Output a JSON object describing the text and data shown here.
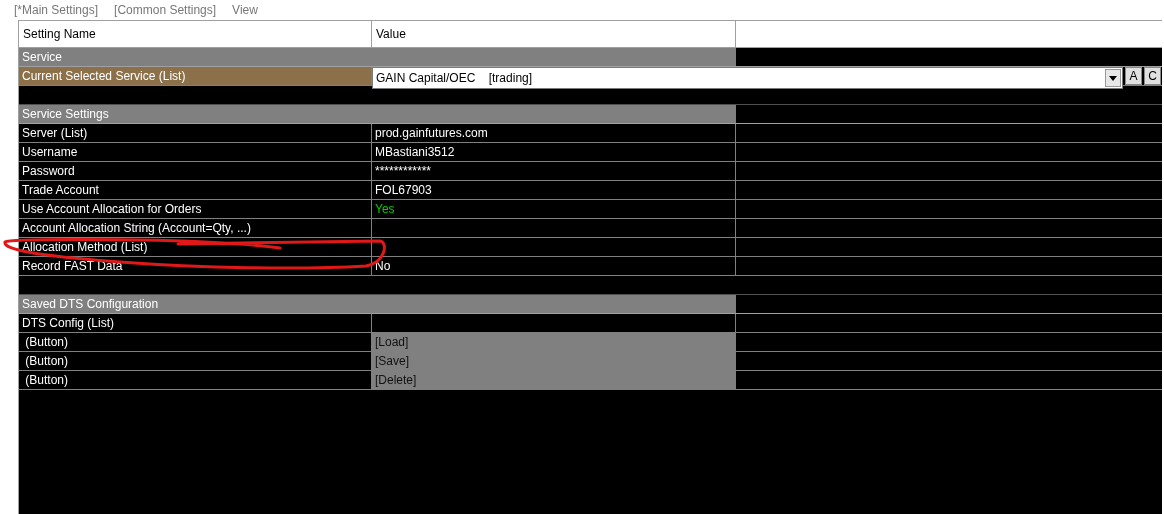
{
  "tabs": [
    {
      "label": "[*Main Settings]"
    },
    {
      "label": "[Common Settings]"
    },
    {
      "label": "View"
    }
  ],
  "columns": [
    "Setting Name",
    "Value"
  ],
  "sections": [
    {
      "title": "Service",
      "rows": [
        {
          "name": "Current Selected Service (List)",
          "kind": "combo",
          "value": "GAIN Capital/OEC    [trading]",
          "buttons": [
            "A",
            "C"
          ],
          "selected": true
        }
      ]
    },
    {
      "title": "Service Settings",
      "rows": [
        {
          "name": "Server (List)",
          "kind": "text",
          "value": "prod.gainfutures.com",
          "selected": false
        },
        {
          "name": "Username",
          "kind": "text",
          "value": "MBastiani3512",
          "selected": false
        },
        {
          "name": "Password",
          "kind": "text",
          "value": "************",
          "selected": false
        },
        {
          "name": "Trade Account",
          "kind": "text",
          "value": "FOL67903",
          "selected": false
        },
        {
          "name": "Use Account Allocation for Orders",
          "kind": "text",
          "value": "Yes",
          "color": "#00d000",
          "selected": false
        },
        {
          "name": "Account Allocation String (Account=Qty, ...)",
          "kind": "text",
          "selected": false
        },
        {
          "name": "Allocation Method (List)",
          "kind": "text",
          "selected": false
        },
        {
          "name": "Record FAST Data",
          "kind": "text",
          "value": "No",
          "selected": false
        }
      ]
    },
    {
      "title": "Saved DTS Configuration",
      "rows": [
        {
          "name": "DTS Config (List)",
          "kind": "text",
          "selected": false
        },
        {
          "name": " (Button)",
          "kind": "button",
          "value": "[Load]",
          "selected": false
        },
        {
          "name": " (Button)",
          "kind": "button",
          "value": "[Save]",
          "selected": false
        },
        {
          "name": " (Button)",
          "kind": "button",
          "value": "[Delete]",
          "selected": false
        }
      ]
    }
  ]
}
